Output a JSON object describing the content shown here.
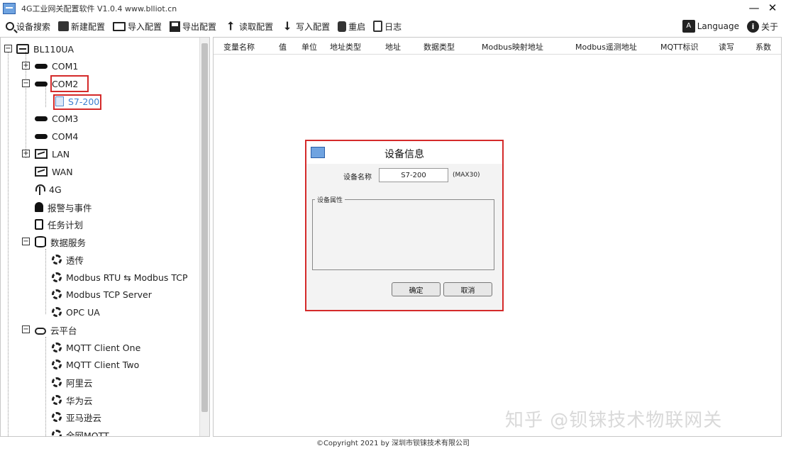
{
  "window": {
    "title": "4G工业网关配置软件 V1.0.4 www.blliot.cn",
    "min_glyph": "—",
    "close_glyph": "✕"
  },
  "toolbar": {
    "items": [
      {
        "label": "设备搜索",
        "icon": "search-icon"
      },
      {
        "label": "新建配置",
        "icon": "new-config-icon"
      },
      {
        "label": "导入配置",
        "icon": "folder-icon"
      },
      {
        "label": "导出配置",
        "icon": "save-icon"
      },
      {
        "label": "读取配置",
        "icon": "upload-icon"
      },
      {
        "label": "写入配置",
        "icon": "download-icon"
      },
      {
        "label": "重启",
        "icon": "restart-icon"
      },
      {
        "label": "日志",
        "icon": "log-icon"
      }
    ],
    "language_label": "Language",
    "language_icon_text": "A",
    "about_label": "关于",
    "about_icon_text": "i"
  },
  "tree": {
    "root": "BL110UA",
    "com1": "COM1",
    "com2": "COM2",
    "s7": "S7-200",
    "com3": "COM3",
    "com4": "COM4",
    "lan": "LAN",
    "wan": "WAN",
    "g4": "4G",
    "alarm": "报警与事件",
    "task": "任务计划",
    "data_service": "数据服务",
    "passthrough": "透传",
    "modbus_rtu": "Modbus RTU ⇆ Modbus TCP",
    "modbus_tcp": "Modbus TCP Server",
    "opcua": "OPC UA",
    "cloud": "云平台",
    "mqtt1": "MQTT Client One",
    "mqtt2": "MQTT Client Two",
    "aliyun": "阿里云",
    "huawei": "华为云",
    "amazon": "亚马逊云",
    "allmqtt": "全网MQTT"
  },
  "grid": {
    "columns": [
      "变量名称",
      "值",
      "单位",
      "地址类型",
      "地址",
      "数据类型",
      "Modbus映射地址",
      "Modbus遥测地址",
      "MQTT标识",
      "读写",
      "系数"
    ]
  },
  "dialog": {
    "title": "设备信息",
    "name_label": "设备名称",
    "name_value": "S7-200",
    "name_hint": "(MAX30)",
    "group_label": "设备属性",
    "ok_label": "确定",
    "cancel_label": "取消"
  },
  "footer": {
    "copyright": "©Copyright 2021 by 深圳市钡铼技术有限公司"
  },
  "watermark": "知乎 @钡铼技术物联网关",
  "colors": {
    "highlight_red": "#d42a2a",
    "accent_blue": "#6fa3e0"
  }
}
